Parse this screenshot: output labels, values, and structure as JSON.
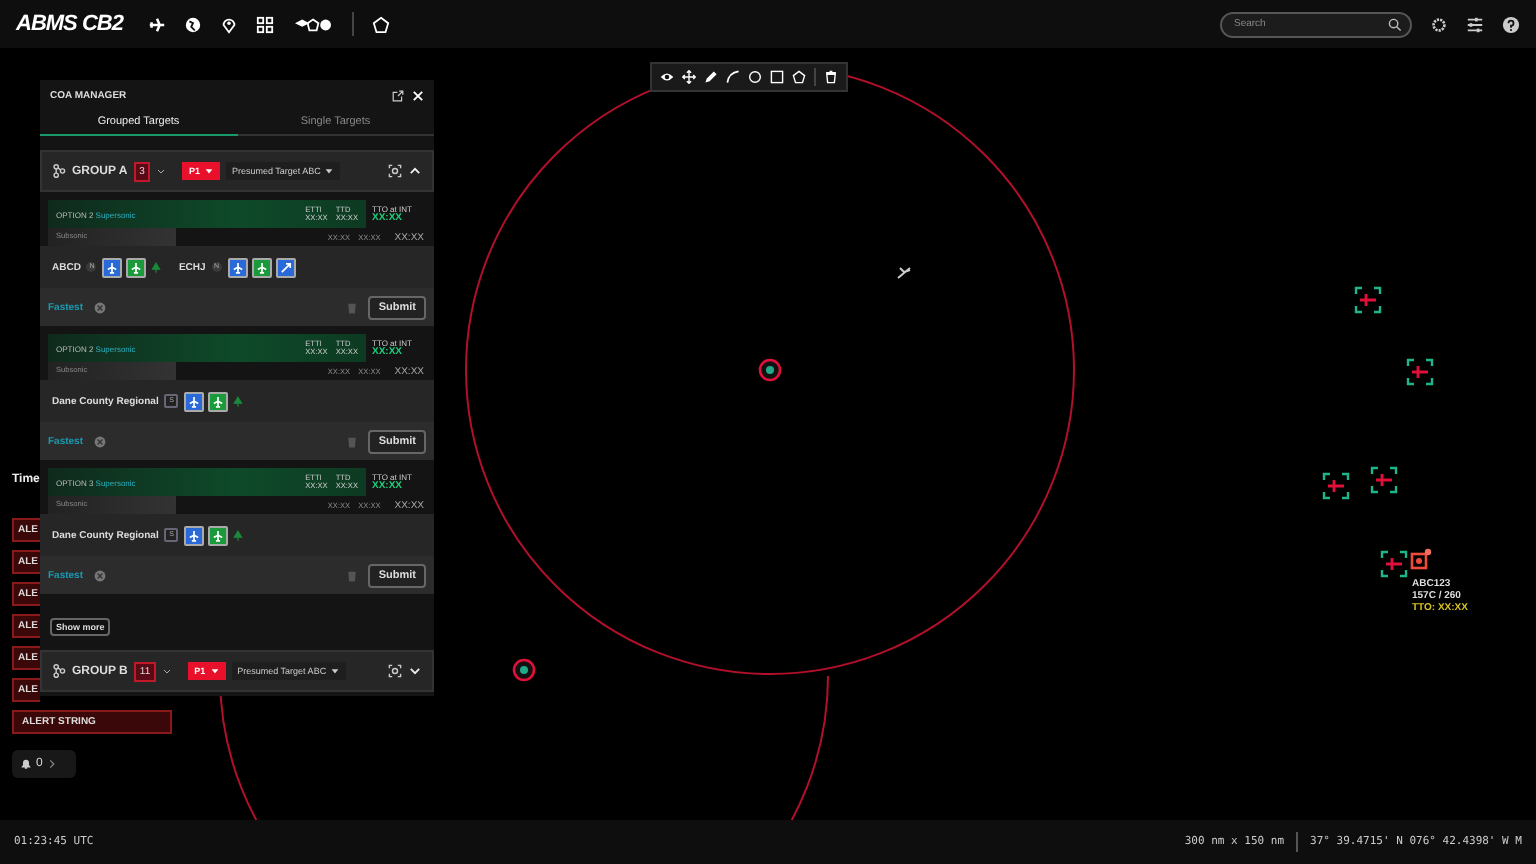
{
  "top_bar": {
    "logo": "ABMS CB2",
    "search": {
      "placeholder": "Search"
    }
  },
  "draw_toolbar": {
    "tools": [
      {
        "kind": "eye"
      },
      {
        "kind": "move"
      },
      {
        "kind": "pen"
      },
      {
        "kind": "curve"
      },
      {
        "kind": "circle"
      },
      {
        "kind": "square"
      },
      {
        "kind": "pentagon"
      },
      {
        "kind": "trash"
      }
    ]
  },
  "alerts": {
    "title": "Time",
    "items": [
      {
        "text": "ALE"
      },
      {
        "text": "ALE"
      },
      {
        "text": "ALE"
      },
      {
        "text": "ALE"
      },
      {
        "text": "ALE"
      },
      {
        "text": "ALE"
      },
      {
        "text": "ALERT STRING"
      }
    ],
    "bell_count": "0"
  },
  "coa_manager": {
    "title": "COA MANAGER",
    "tabs": [
      {
        "label": "Grouped Targets",
        "selected": true
      },
      {
        "label": "Single Targets",
        "selected": false
      }
    ],
    "groups": [
      {
        "name": "GROUP A",
        "count": "3",
        "priority": "P1",
        "target": "Presumed Target ABC",
        "expanded": true,
        "options": [
          {
            "label": "OPTION 2",
            "speed": "Supersonic",
            "etti_label": "ETTI",
            "etti": "XX:XX",
            "ttd_label": "TTD",
            "ttd": "XX:XX",
            "tto_label": "TTO at INT",
            "tto": "XX:XX",
            "sub_label": "Subsonic",
            "sub_etti": "XX:XX",
            "sub_ttd": "XX:XX",
            "sub_tto": "XX:XX",
            "bases": [
              {
                "name": "ABCD",
                "badge": "N",
                "assets": [
                  {
                    "kind": "air"
                  },
                  {
                    "kind": "ground"
                  },
                  {
                    "kind": "tree"
                  }
                ]
              },
              {
                "name": "ECHJ",
                "badge": "N",
                "assets": [
                  {
                    "kind": "air"
                  },
                  {
                    "kind": "ground"
                  },
                  {
                    "kind": "strike"
                  }
                ]
              }
            ],
            "tag": "Fastest",
            "action": "Submit"
          },
          {
            "label": "OPTION 2",
            "speed": "Supersonic",
            "etti_label": "ETTI",
            "etti": "XX:XX",
            "ttd_label": "TTD",
            "ttd": "XX:XX",
            "tto_label": "TTO at INT",
            "tto": "XX:XX",
            "sub_label": "Subsonic",
            "sub_etti": "XX:XX",
            "sub_ttd": "XX:XX",
            "sub_tto": "XX:XX",
            "bases": [
              {
                "name": "Dane County Regional",
                "badge": "S",
                "assets": [
                  {
                    "kind": "air"
                  },
                  {
                    "kind": "ground"
                  },
                  {
                    "kind": "tree"
                  }
                ]
              }
            ],
            "tag": "Fastest",
            "action": "Submit"
          },
          {
            "label": "OPTION 3",
            "speed": "Supersonic",
            "etti_label": "ETTI",
            "etti": "XX:XX",
            "ttd_label": "TTD",
            "ttd": "XX:XX",
            "tto_label": "TTO at INT",
            "tto": "XX:XX",
            "sub_label": "Subsonic",
            "sub_etti": "XX:XX",
            "sub_ttd": "XX:XX",
            "sub_tto": "XX:XX",
            "bases": [
              {
                "name": "Dane County Regional",
                "badge": "S",
                "assets": [
                  {
                    "kind": "air"
                  },
                  {
                    "kind": "ground"
                  },
                  {
                    "kind": "tree"
                  }
                ]
              }
            ],
            "tag": "Fastest",
            "action": "Submit"
          }
        ],
        "show_more": "Show more"
      },
      {
        "name": "GROUP B",
        "count": "11",
        "priority": "P1",
        "target": "Presumed Target ABC",
        "expanded": false
      }
    ]
  },
  "map": {
    "targets": [
      {
        "selected": false
      },
      {
        "selected": false
      },
      {
        "selected": false
      },
      {
        "selected": false
      },
      {
        "selected": false
      },
      {
        "selected": true
      }
    ],
    "selected_label": {
      "callsign": "ABC123",
      "info": "157C / 260",
      "tto": "TTO: XX:XX"
    }
  },
  "status_bar": {
    "time": "01:23:45 UTC",
    "scale": "300 nm x 150 nm",
    "coords": "37° 39.4715' N 076° 42.4398' W M"
  }
}
